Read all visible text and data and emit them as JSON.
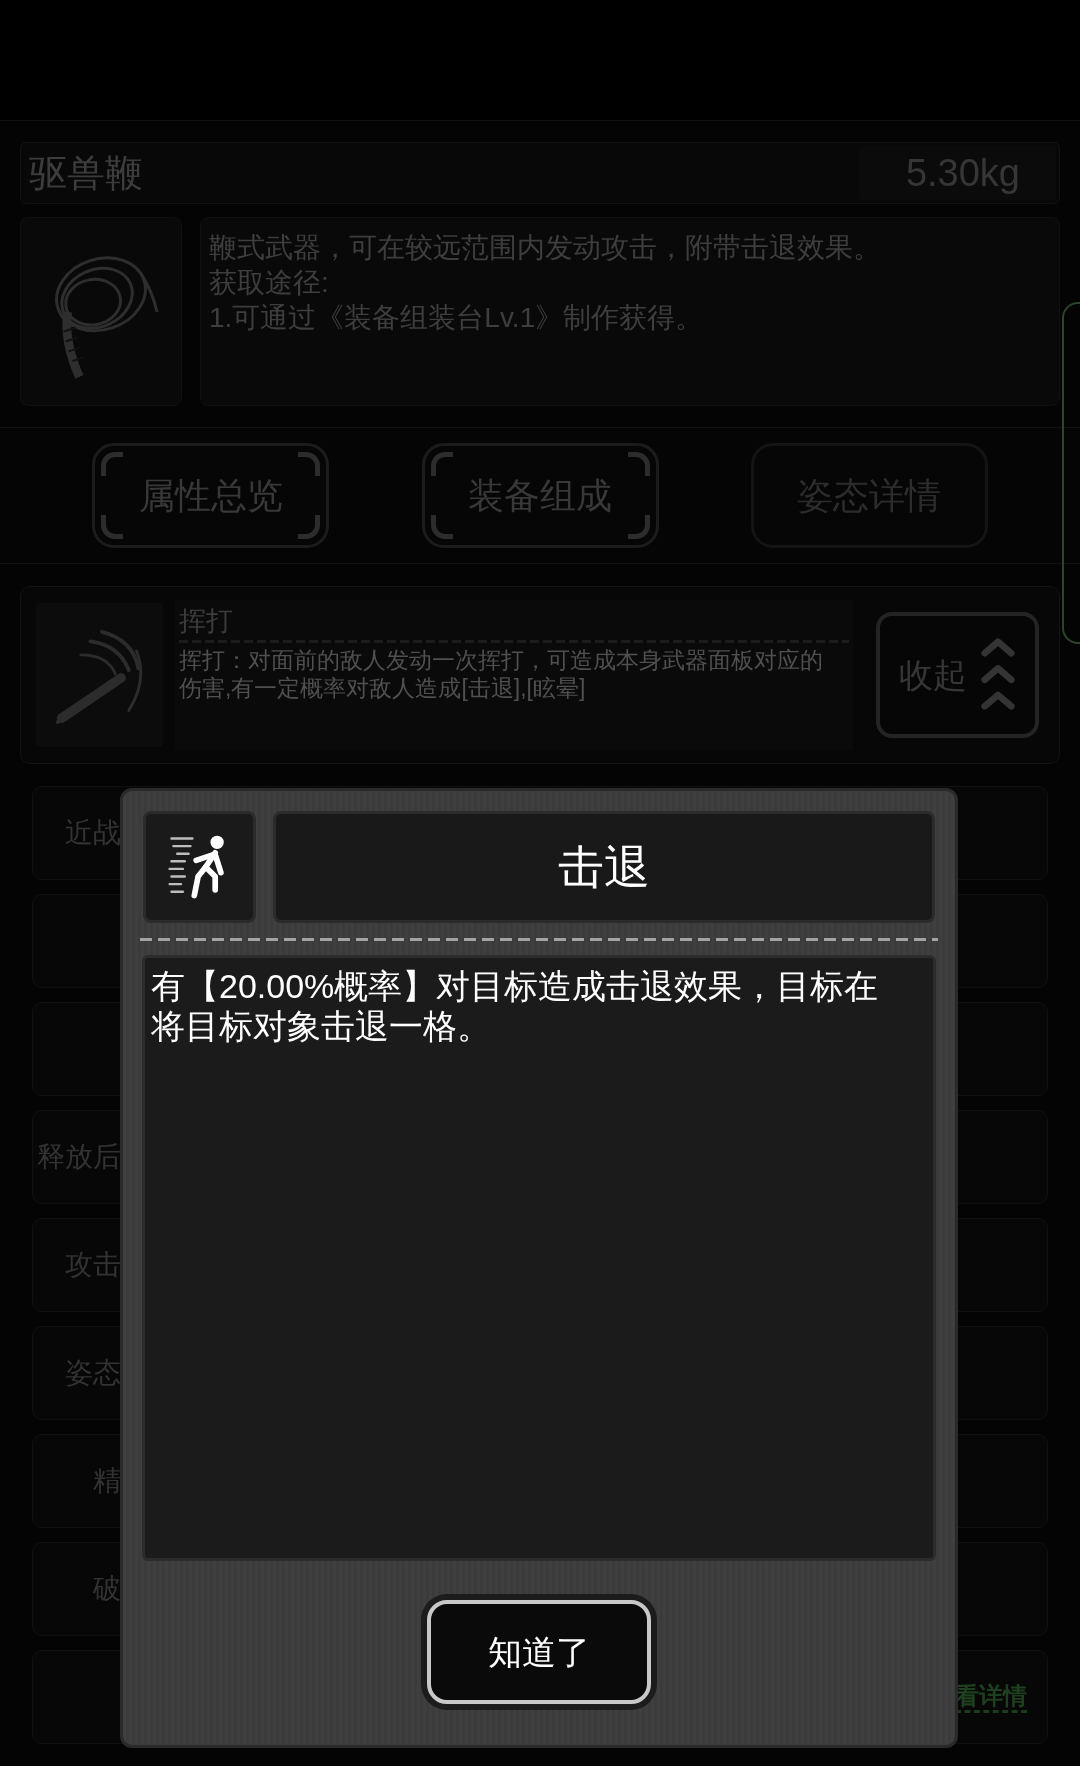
{
  "item": {
    "name": "驱兽鞭",
    "weight": "5.30kg",
    "description": [
      "鞭式武器，可在较远范围内发动攻击，附带击退效果。",
      "获取途径:",
      "1.可通过《装备组装台Lv.1》制作获得。"
    ]
  },
  "tabs": [
    {
      "label": "属性总览",
      "disabled": false
    },
    {
      "label": "装备组成",
      "disabled": false
    },
    {
      "label": "姿态详情",
      "disabled": true
    }
  ],
  "skill": {
    "name": "挥打",
    "description": "挥打：对面前的敌人发动一次挥打，可造成本身武器面板对应的伤害,有一定概率对敌人造成[击退],[眩晕]",
    "collapse_button": "收起"
  },
  "rows": [
    {
      "label": "近战"
    },
    {},
    {},
    {
      "label": "释放后"
    },
    {
      "label": "攻击"
    },
    {
      "label": "姿态"
    },
    {
      "label": "精"
    },
    {
      "label": "破"
    },
    {
      "link": "看详情"
    }
  ],
  "dialog": {
    "title": "击退",
    "message": "有【20.00%概率】对目标造成击退效果，目标在将目标对象击退一格。",
    "button": "知道了"
  }
}
